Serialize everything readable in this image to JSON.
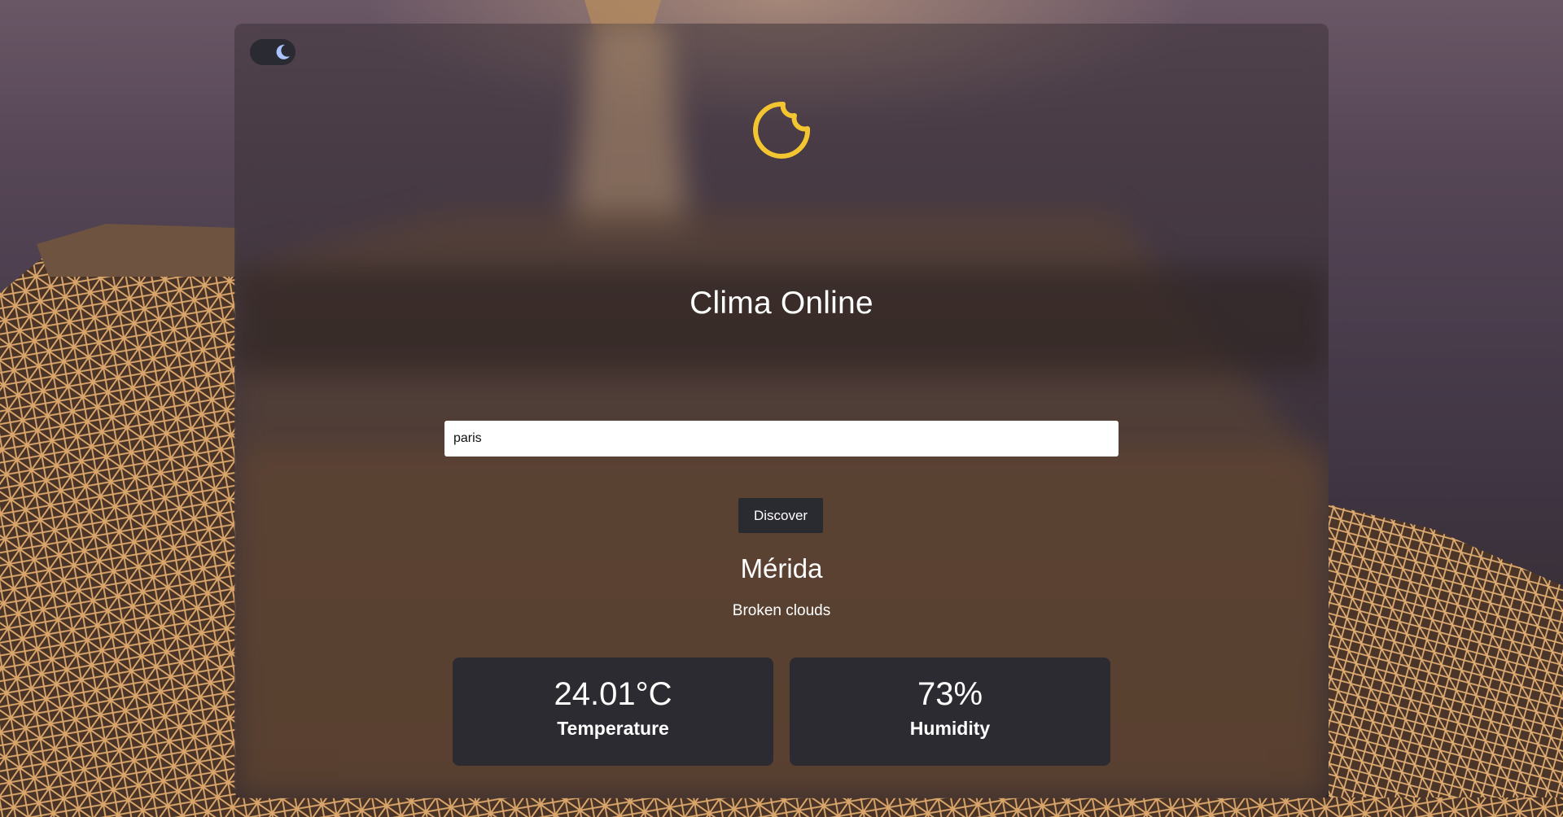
{
  "app": {
    "title": "Clima Online"
  },
  "theme_toggle": {
    "icon": "moon-icon",
    "state": "dark"
  },
  "logo": {
    "icon": "weather-logo-icon",
    "color": "#f2c531"
  },
  "search": {
    "value": "paris",
    "placeholder": ""
  },
  "actions": {
    "discover_label": "Discover"
  },
  "weather": {
    "city": "Mérida",
    "description": "Broken clouds",
    "temperature": {
      "value": "24.01°C",
      "label": "Temperature"
    },
    "humidity": {
      "value": "73%",
      "label": "Humidity"
    }
  },
  "colors": {
    "accent": "#f2c531",
    "card_bg": "#2c2b31",
    "button_bg": "#2a2a31",
    "moon": "#a9c4ff"
  }
}
